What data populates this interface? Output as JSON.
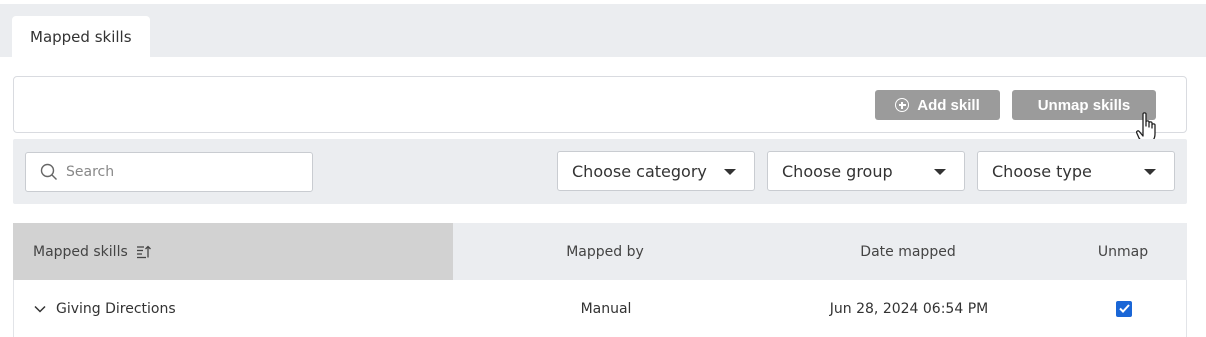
{
  "tabs": [
    {
      "label": "Mapped skills",
      "active": true
    }
  ],
  "actions": {
    "add_skill_label": "Add skill",
    "unmap_skills_label": "Unmap skills"
  },
  "filters": {
    "search_placeholder": "Search",
    "category": "Choose category",
    "group": "Choose group",
    "type": "Choose type"
  },
  "table": {
    "columns": [
      "Mapped skills",
      "Mapped by",
      "Date mapped",
      "Unmap"
    ],
    "rows": [
      {
        "skill": "Giving Directions",
        "mapped_by": "Manual",
        "date_mapped": "Jun 28, 2024 06:54 PM",
        "unmap_checked": true
      }
    ]
  },
  "colors": {
    "button_bg": "#9b9b9b",
    "checkbox_accent": "#1a66d6",
    "panel_bg": "#ebedf0",
    "sorted_header_bg": "#d2d2d2"
  }
}
